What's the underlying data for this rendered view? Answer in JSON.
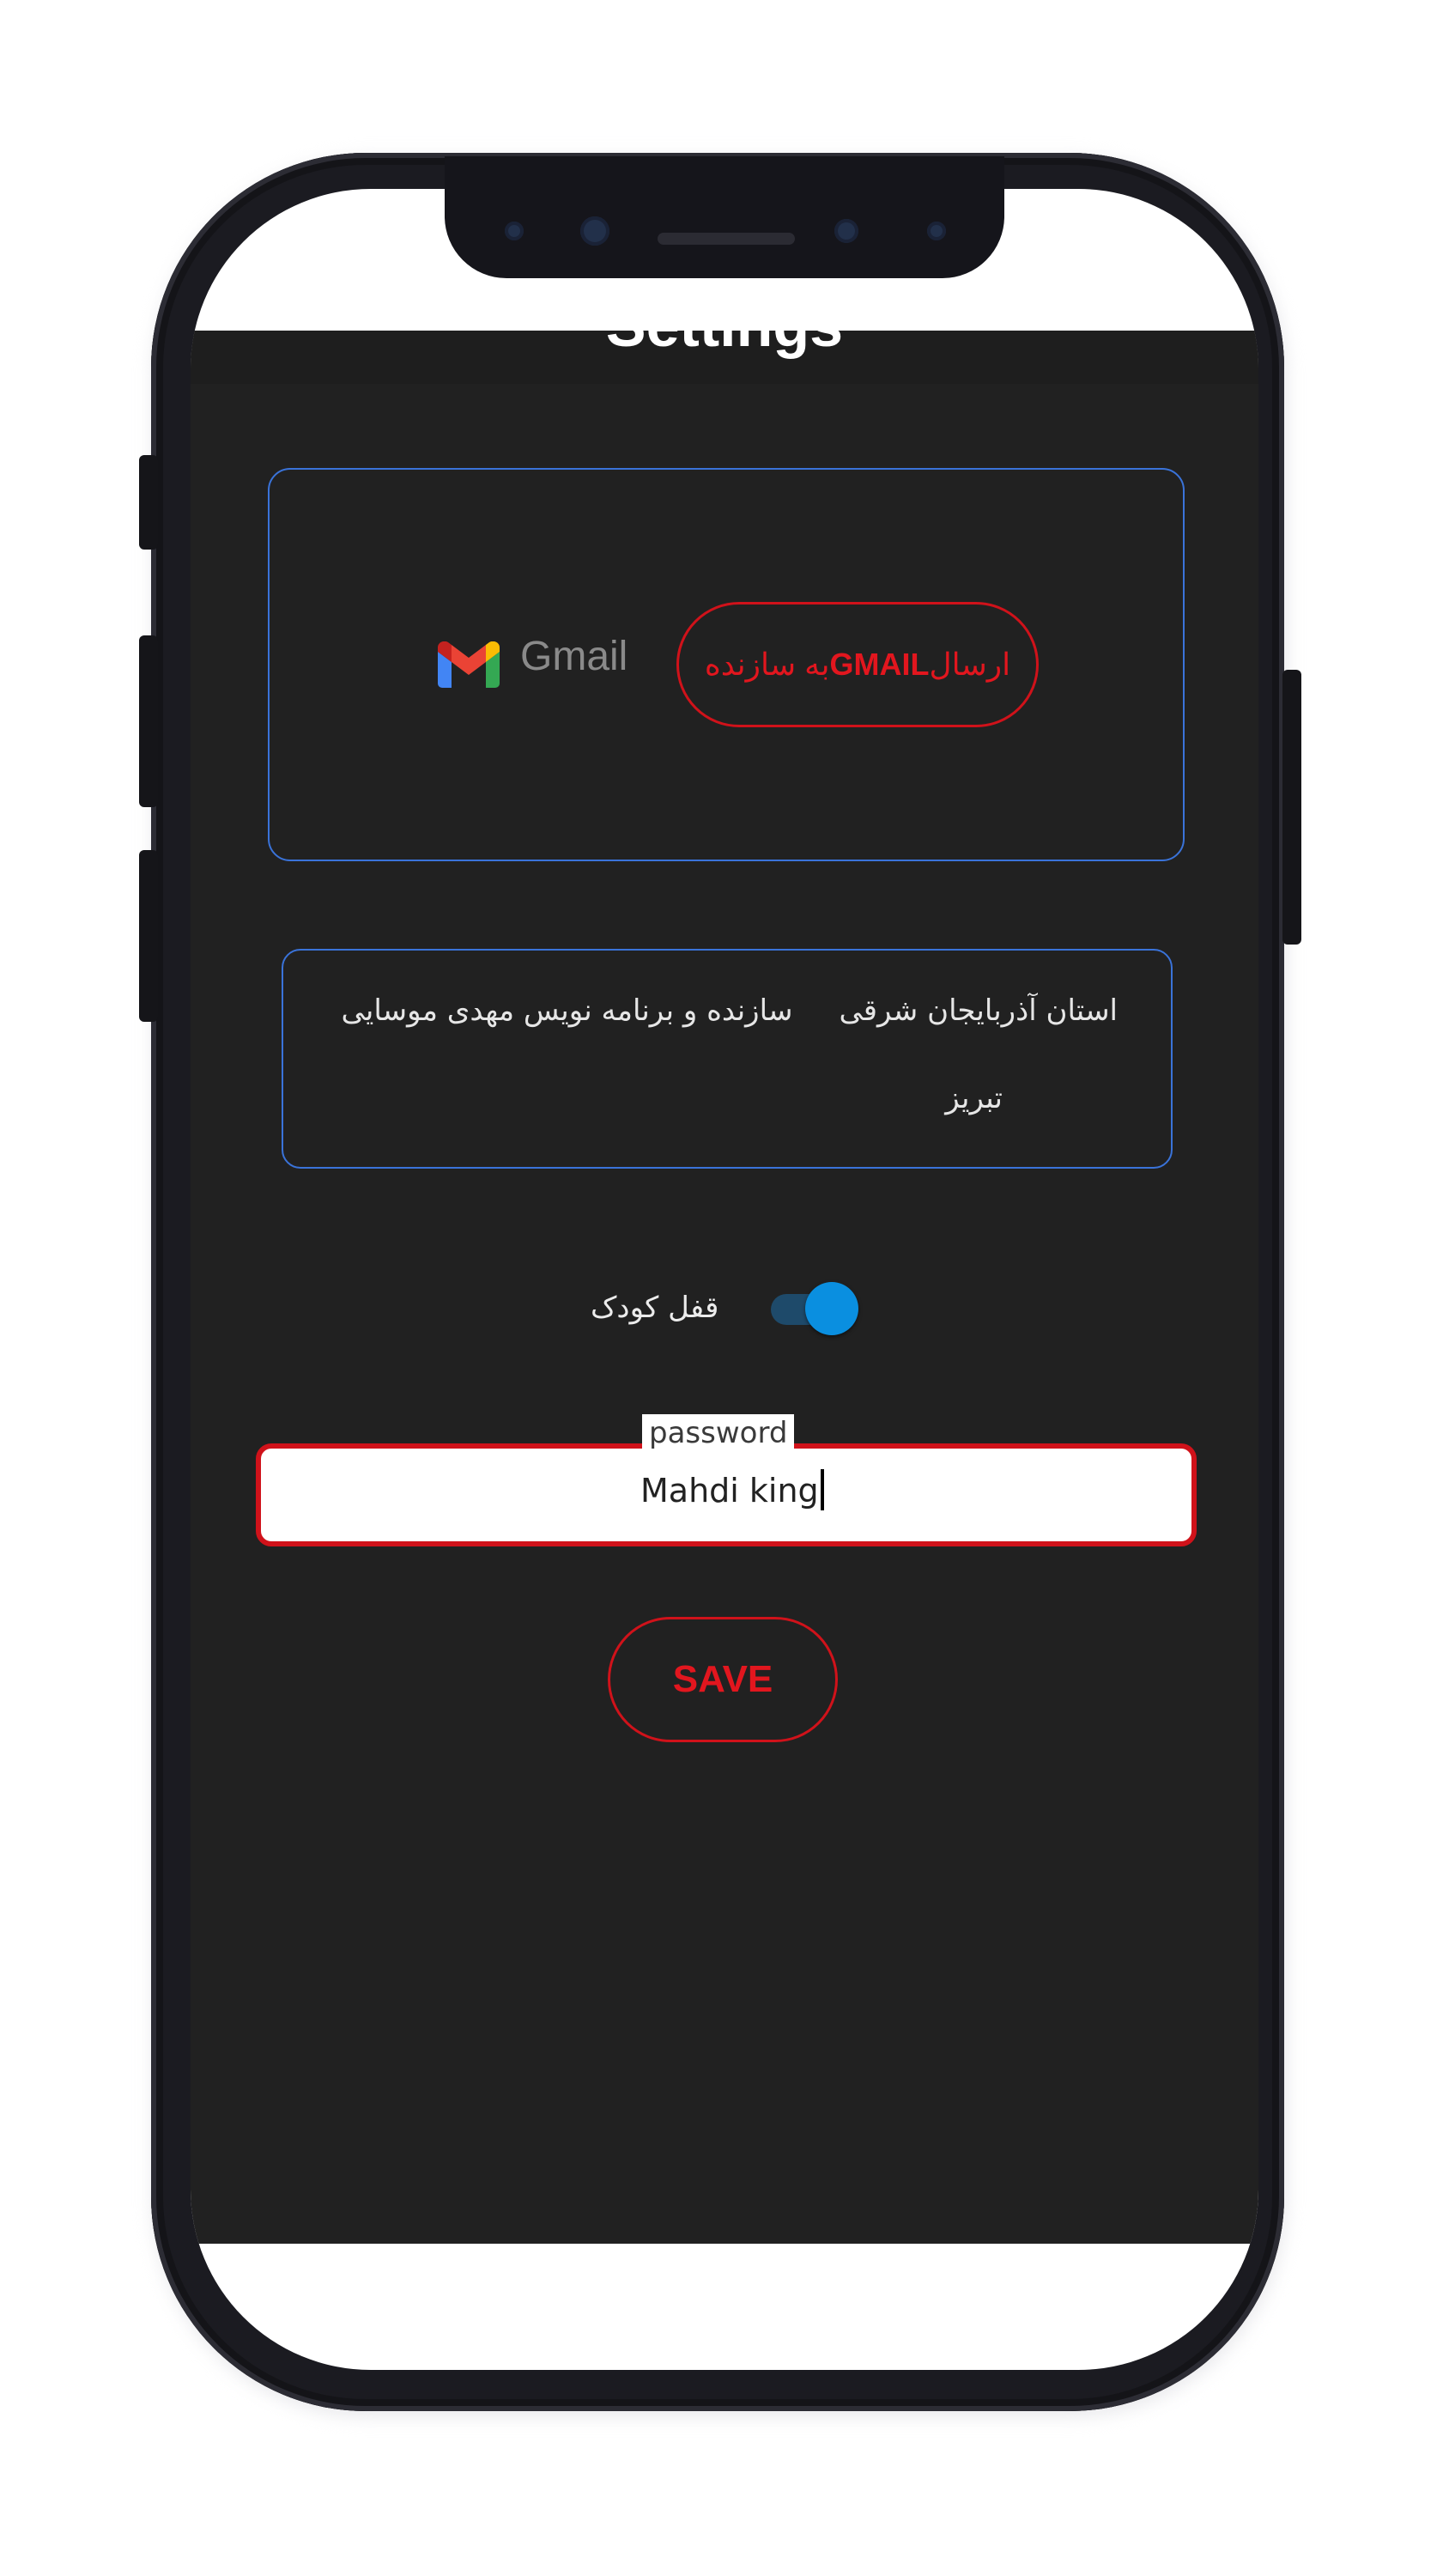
{
  "app_bar": {
    "title": "Settings"
  },
  "gmail_card": {
    "logo_text": "Gmail",
    "send_button": {
      "prefix": "ارسال ",
      "highlight": "GMAIL",
      "suffix": " به سازنده"
    }
  },
  "info_card": {
    "province": "استان آذربایجان شرقی",
    "developer": "سازنده و برنامه نویس مهدی موسایی",
    "city": "تبریز"
  },
  "child_lock": {
    "label": "قفل کودک",
    "enabled": true
  },
  "password": {
    "label": "password",
    "value": "Mahdi king"
  },
  "save_button": {
    "label": "SAVE"
  },
  "colors": {
    "accent": "#d0121a",
    "border_blue": "#3a73d9",
    "background": "#212121",
    "toggle": "#0a8fe0"
  },
  "icons": {
    "gmail": "gmail-logo-icon"
  }
}
